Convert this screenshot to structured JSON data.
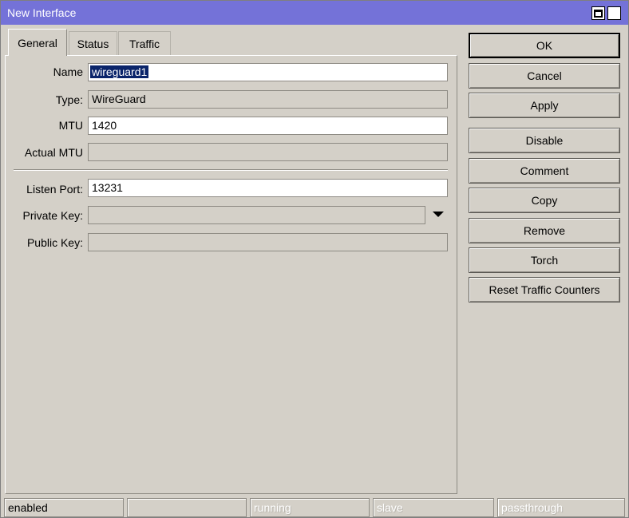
{
  "window": {
    "title": "New Interface",
    "titlebar_color": "#7472d8"
  },
  "tabs": [
    {
      "label": "General",
      "active": true
    },
    {
      "label": "Status",
      "active": false
    },
    {
      "label": "Traffic",
      "active": false
    }
  ],
  "general": {
    "name_label": "Name",
    "name_value": "wireguard1",
    "type_label": "Type:",
    "type_value": "WireGuard",
    "mtu_label": "MTU",
    "mtu_value": "1420",
    "actual_mtu_label": "Actual MTU",
    "actual_mtu_value": "",
    "listen_port_label": "Listen Port:",
    "listen_port_value": "13231",
    "private_key_label": "Private Key:",
    "private_key_value": "",
    "public_key_label": "Public Key:",
    "public_key_value": ""
  },
  "buttons": {
    "ok": "OK",
    "cancel": "Cancel",
    "apply": "Apply",
    "disable": "Disable",
    "comment": "Comment",
    "copy": "Copy",
    "remove": "Remove",
    "torch": "Torch",
    "reset_traffic_counters": "Reset Traffic Counters"
  },
  "status_bar": [
    {
      "text": "enabled",
      "active": true
    },
    {
      "text": "",
      "active": false
    },
    {
      "text": "running",
      "active": false
    },
    {
      "text": "slave",
      "active": false
    },
    {
      "text": "passthrough",
      "active": false
    }
  ],
  "icons": {
    "maximize": "maximize-icon",
    "close": "close-icon",
    "dropdown": "dropdown-arrow-icon"
  }
}
